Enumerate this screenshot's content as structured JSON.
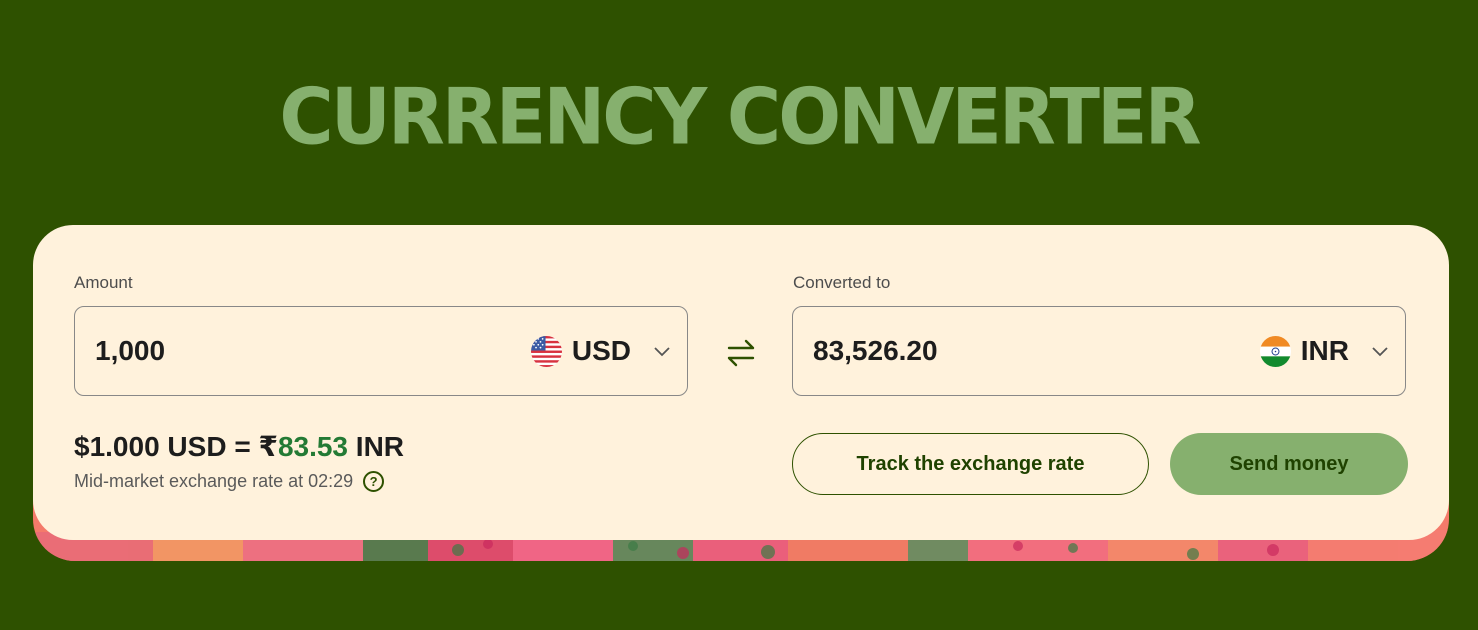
{
  "page": {
    "title": "CURRENCY CONVERTER",
    "colors": {
      "background": "#2e5100",
      "title": "#86b06e",
      "card": "#fff2dc",
      "accent_green": "#237a34",
      "button_fill": "#86b06e"
    }
  },
  "converter": {
    "amount": {
      "label": "Amount",
      "value": "1,000",
      "currency_code": "USD",
      "flag_icon": "us-flag-icon"
    },
    "converted": {
      "label": "Converted to",
      "value": "83,526.20",
      "currency_code": "INR",
      "flag_icon": "india-flag-icon"
    },
    "swap_icon": "swap-arrows-icon",
    "rate": {
      "prefix": "$1.000 USD = ₹",
      "value": "83.53",
      "suffix": " INR",
      "note": "Mid-market exchange rate at 02:29",
      "help_icon": "question-circle-icon",
      "help_glyph": "?"
    },
    "buttons": {
      "track": "Track the exchange rate",
      "send": "Send money"
    }
  }
}
